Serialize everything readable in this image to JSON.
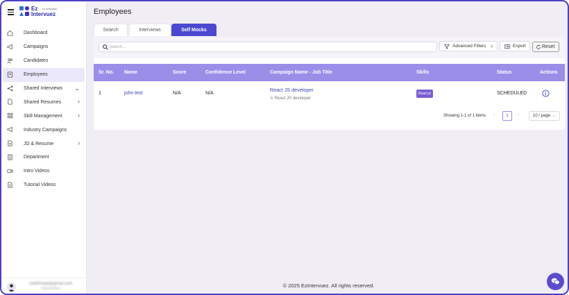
{
  "brand": {
    "line1": "Ez",
    "line2": "Intervuez",
    "tagline": "(AI-POWERED)"
  },
  "sidebar": {
    "items": [
      {
        "label": "Dashboard",
        "icon": "home-icon"
      },
      {
        "label": "Campaigns",
        "icon": "megaphone-icon"
      },
      {
        "label": "Candidates",
        "icon": "users-icon"
      },
      {
        "label": "Employees",
        "icon": "badge-icon",
        "active": true
      },
      {
        "label": "Shared Interviews",
        "icon": "share-icon",
        "expand": "down"
      },
      {
        "label": "Shared Resumes",
        "icon": "document-icon",
        "expand": "right"
      },
      {
        "label": "Skill Management",
        "icon": "grid-icon",
        "expand": "right"
      },
      {
        "label": "Industry Campaigns",
        "icon": "megaphone-icon"
      },
      {
        "label": "JD & Resume",
        "icon": "document-icon",
        "expand": "right"
      },
      {
        "label": "Department",
        "icon": "building-icon"
      },
      {
        "label": "Intro Videos",
        "icon": "video-icon"
      },
      {
        "label": "Tutorial Videos",
        "icon": "document-icon"
      }
    ],
    "chevrons": {
      "down": "⌄",
      "right": "›"
    },
    "user": {
      "email": "sedtfhnwje@gmail.com",
      "role": "Organization"
    }
  },
  "header": {
    "title": "Employees"
  },
  "tabs": [
    {
      "label": "Search"
    },
    {
      "label": "Interviews"
    },
    {
      "label": "Self Mocks",
      "active": true
    }
  ],
  "toolbar": {
    "search_placeholder": "Search...",
    "search_value": "",
    "advanced_filters": "Advanced Filters",
    "export": "Export",
    "reset": "Reset"
  },
  "table": {
    "columns": [
      "Sr. No.",
      "Name",
      "Score",
      "Confidence Level",
      "Campaign Name - Job Title",
      "Skills",
      "Status",
      "Actions"
    ],
    "rows": [
      {
        "sr": "1",
        "name": "john test",
        "score": "N/A",
        "confidence": "N/A",
        "campaign": "React JS developer",
        "job_title": "↳ React JS developer",
        "skill": "React.js",
        "status": "SCHEDULED"
      }
    ]
  },
  "pagination": {
    "showing": "Showing 1-1 of 1 items",
    "prev": "‹",
    "page": "1",
    "next": "›",
    "page_size": "10 / page",
    "dropdown": "⌄"
  },
  "footer": {
    "text": "© 2025 EzIntervuez. All rights reserved."
  },
  "colors": {
    "accent": "#4b49cf",
    "header_bg": "#9a8ee8",
    "border": "#4b3fc9",
    "bg": "#f1edf5"
  }
}
